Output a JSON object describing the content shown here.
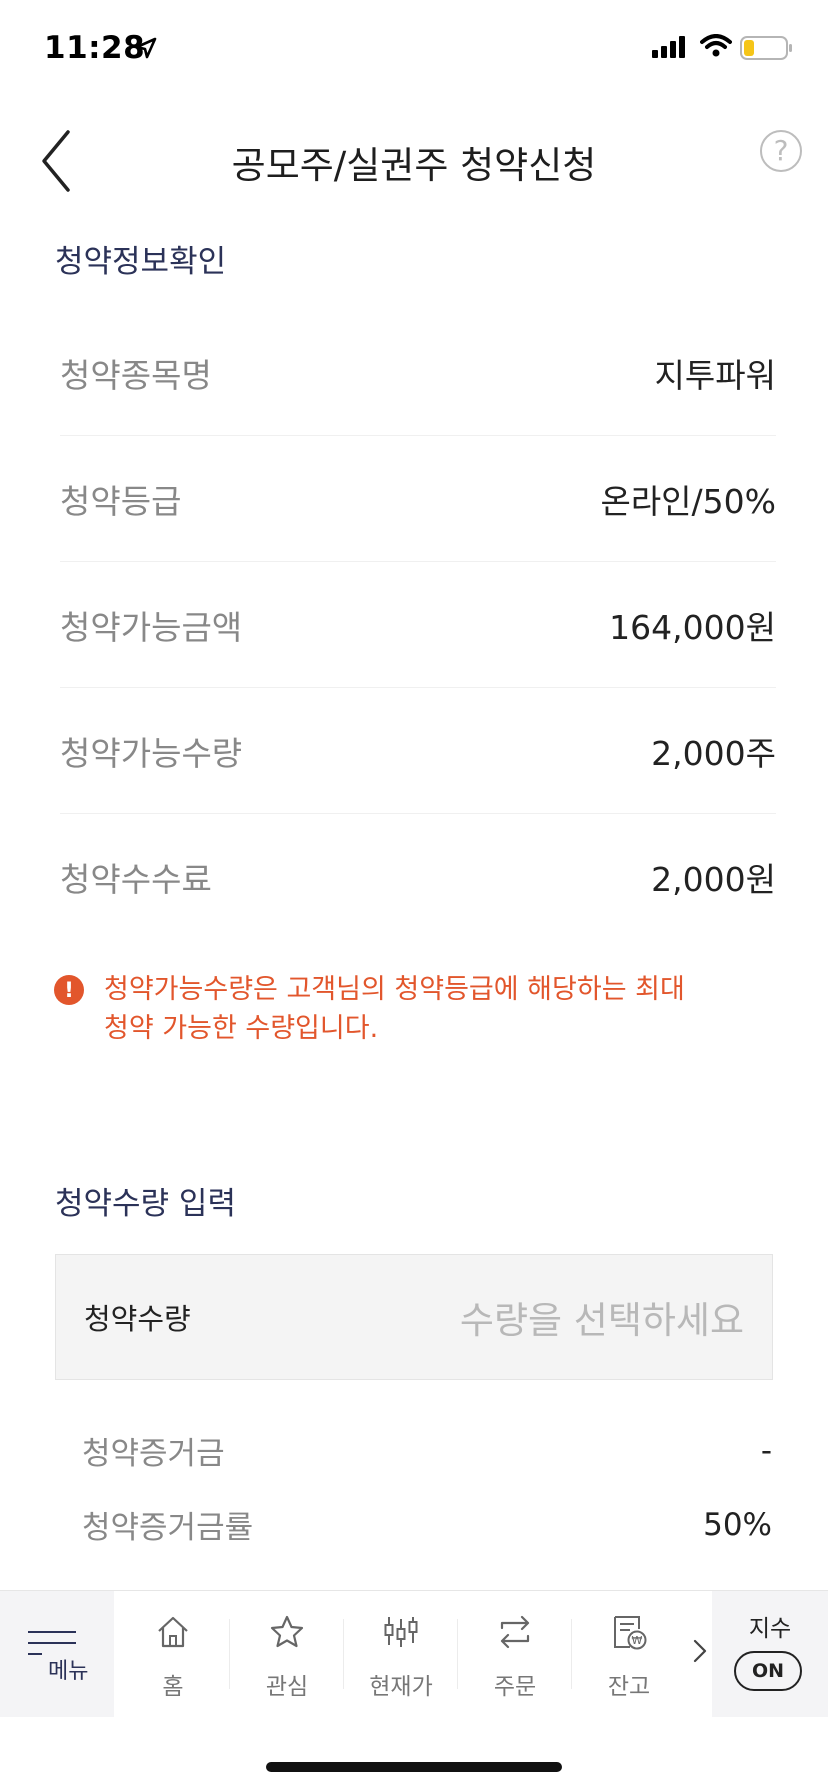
{
  "status_bar": {
    "time": "11:28",
    "battery_color": "#f5c518"
  },
  "header": {
    "title": "공모주/실권주 청약신청",
    "help_label": "?"
  },
  "info_section": {
    "title": "청약정보확인",
    "rows": [
      {
        "label": "청약종목명",
        "value": "지투파워"
      },
      {
        "label": "청약등급",
        "value": "온라인/50%"
      },
      {
        "label": "청약가능금액",
        "value": "164,000원"
      },
      {
        "label": "청약가능수량",
        "value": "2,000주"
      },
      {
        "label": "청약수수료",
        "value": "2,000원"
      }
    ]
  },
  "notice": {
    "icon": "!",
    "text_line1": "청약가능수량은 고객님의 청약등급에 해당하는 최대",
    "text_line2": "청약 가능한 수량입니다.",
    "color": "#e2562c"
  },
  "quantity_section": {
    "title": "청약수량 입력",
    "input_label": "청약수량",
    "placeholder": "수량을 선택하세요",
    "deposit_label": "청약증거금",
    "deposit_value": "-",
    "deposit_rate_label": "청약증거금률",
    "deposit_rate_value": "50%"
  },
  "bottom_nav": {
    "menu_label": "메뉴",
    "items": [
      {
        "label": "홈",
        "icon": "home-icon"
      },
      {
        "label": "관심",
        "icon": "star-icon"
      },
      {
        "label": "현재가",
        "icon": "candlestick-icon"
      },
      {
        "label": "주문",
        "icon": "exchange-arrows-icon"
      },
      {
        "label": "잔고",
        "icon": "balance-icon"
      }
    ],
    "index_label": "지수",
    "index_toggle": "ON"
  }
}
